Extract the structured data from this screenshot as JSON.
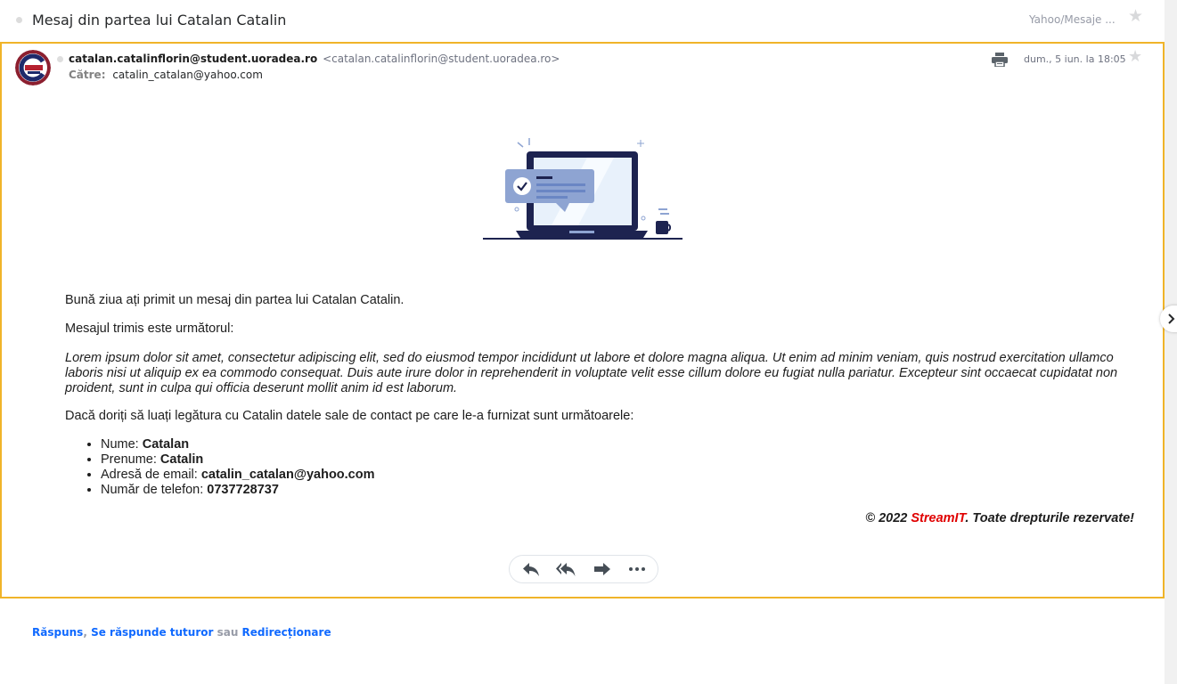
{
  "header": {
    "subject": "Mesaj din partea lui Catalan Catalin",
    "folder": "Yahoo/Mesaje ..."
  },
  "message": {
    "sender_name": "catalan.catalinflorin@student.uoradea.ro",
    "sender_address": "<catalan.catalinflorin@student.uoradea.ro>",
    "to_label": "Către:",
    "to_value": "catalin_catalan@yahoo.com",
    "date": "dum., 5 iun. la 18:05"
  },
  "body": {
    "greeting": "Bună ziua ați primit un mesaj din partea lui Catalan Catalin.",
    "intro": "Mesajul trimis este următorul:",
    "lorem": "Lorem ipsum dolor sit amet, consectetur adipiscing elit, sed do eiusmod tempor incididunt ut labore et dolore magna aliqua. Ut enim ad minim veniam, quis nostrud exercitation ullamco laboris nisi ut aliquip ex ea commodo consequat. Duis aute irure dolor in reprehenderit in voluptate velit esse cillum dolore eu fugiat nulla pariatur. Excepteur sint occaecat cupidatat non proident, sunt in culpa qui officia deserunt mollit anim id est laborum.",
    "contact_intro": "Dacă doriți să luați legătura cu Catalin datele sale de contact pe care le-a furnizat sunt următoarele:",
    "details": [
      {
        "label": "Nume: ",
        "value": "Catalan"
      },
      {
        "label": "Prenume: ",
        "value": "Catalin"
      },
      {
        "label": "Adresă de email: ",
        "value": "catalin_catalan@yahoo.com"
      },
      {
        "label": "Număr de telefon: ",
        "value": "0737728737"
      }
    ],
    "copyright_prefix": "© 2022 ",
    "brand": "StreamIT",
    "copyright_suffix": ". Toate drepturile rezervate!",
    "brand_color": "#e00000"
  },
  "footer": {
    "reply": "Răspuns",
    "comma": ", ",
    "reply_all": "Se răspunde tuturor",
    "or": " sau ",
    "forward": "Redirecționare"
  },
  "icons": [
    "print-icon",
    "star-icon",
    "reply-icon",
    "reply-all-icon",
    "forward-icon",
    "more-icon",
    "chevron-right-icon"
  ],
  "colors": {
    "focus_border": "#f0b429",
    "link": "#0f69ff"
  }
}
